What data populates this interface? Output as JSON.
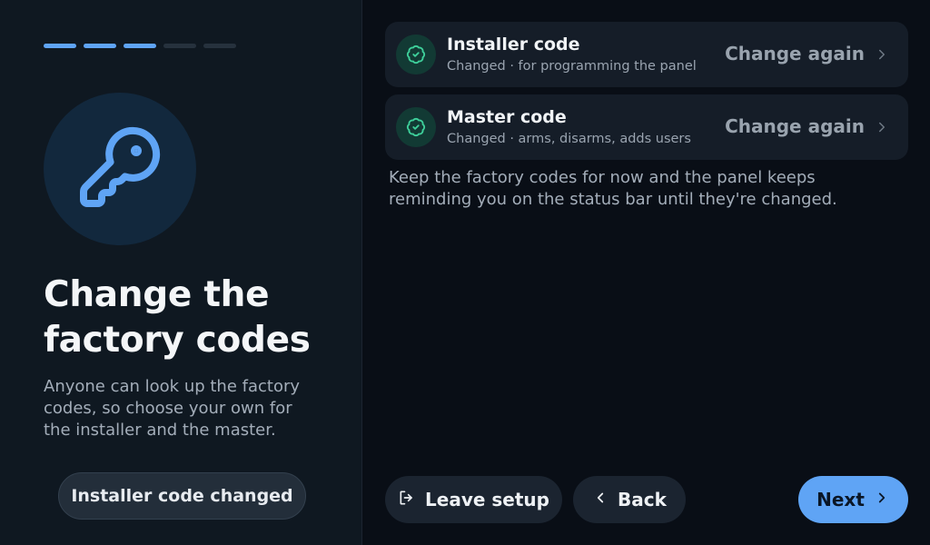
{
  "progress": {
    "total_steps": 5,
    "completed_steps": 3
  },
  "left": {
    "icon": "key-icon",
    "title": "Change the factory codes",
    "subtitle": "Anyone can look up the factory codes, so choose your own for the installer and the master.",
    "toast": "Installer code changed"
  },
  "codes": [
    {
      "title": "Installer code",
      "subtitle": "Changed · for programming the panel",
      "action": "Change again",
      "status_icon": "check-badge-icon"
    },
    {
      "title": "Master code",
      "subtitle": "Changed · arms, disarms, adds users",
      "action": "Change again",
      "status_icon": "check-badge-icon"
    }
  ],
  "note": "Keep the factory codes for now and the panel keeps reminding you on the status bar until they're changed.",
  "footer": {
    "leave_label": "Leave setup",
    "back_label": "Back",
    "next_label": "Next"
  },
  "colors": {
    "accent": "#5fa4f5",
    "success": "#3ecf9a",
    "background": "#090e16",
    "panel": "#0f1821"
  }
}
